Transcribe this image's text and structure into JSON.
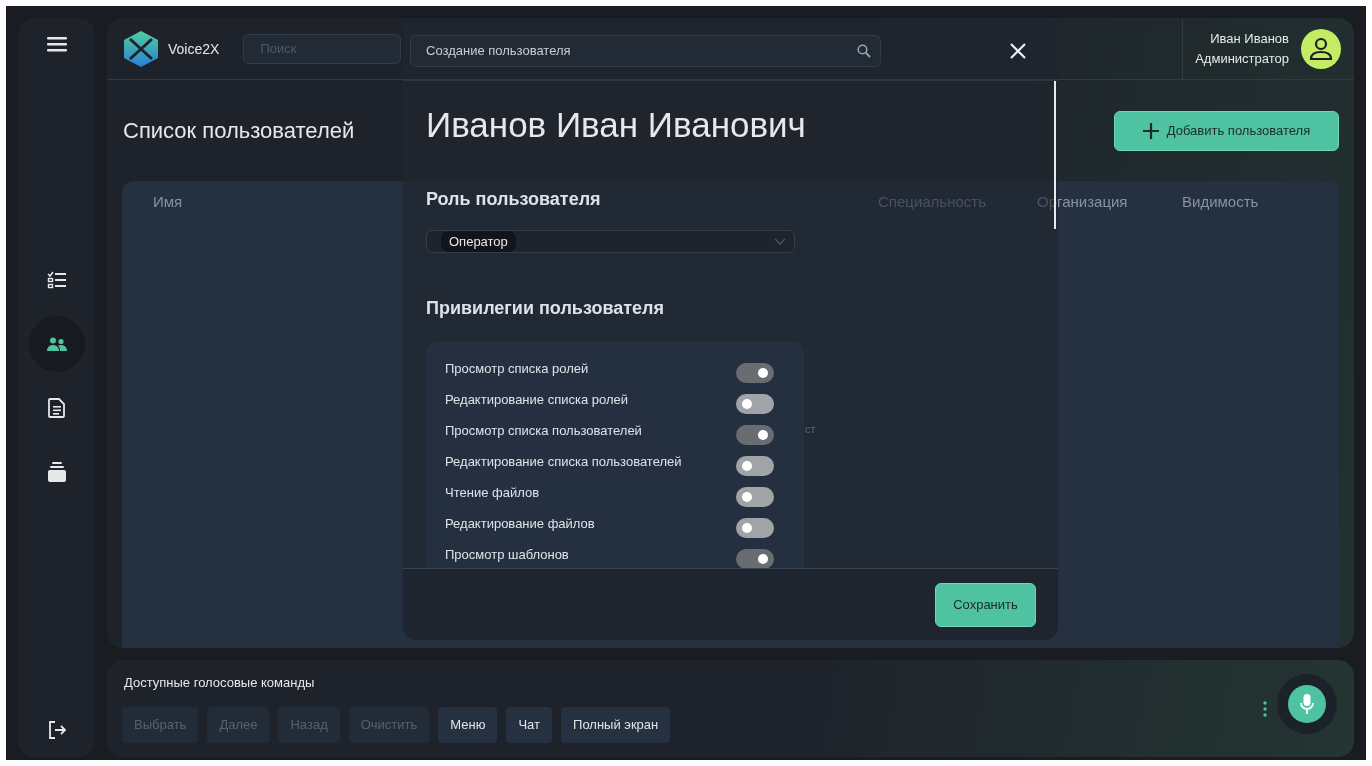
{
  "sidebar": {
    "nav": [
      {
        "kind": "checklist",
        "selected": false
      },
      {
        "kind": "users",
        "selected": true
      },
      {
        "kind": "document",
        "selected": false
      },
      {
        "kind": "archive",
        "selected": false
      }
    ]
  },
  "header": {
    "logo_text": "Voice2X",
    "search": {
      "placeholder": "Поиск"
    },
    "user": {
      "name": "Иван Иванов",
      "role": "Администратор"
    }
  },
  "page": {
    "title": "Список пользователей",
    "add_button": "Добавить пользователя"
  },
  "table": {
    "columns": [
      "Имя",
      "Специальность",
      "Организация",
      "Видимость"
    ],
    "empty_text": "ст"
  },
  "voice_bar": {
    "title": "Доступные голосовые команды",
    "commands": [
      {
        "label": "Выбрать",
        "disabled": true
      },
      {
        "label": "Далее",
        "disabled": true
      },
      {
        "label": "Назад",
        "disabled": true
      },
      {
        "label": "Очистить",
        "disabled": true
      },
      {
        "label": "Меню",
        "disabled": false
      },
      {
        "label": "Чат",
        "disabled": false
      },
      {
        "label": "Полный экран",
        "disabled": false
      }
    ]
  },
  "modal": {
    "header_field": {
      "value": "Создание пользователя"
    },
    "name": "Иванов Иван Иванович",
    "role_title": "Роль пользователя",
    "role": {
      "chip": "Оператор"
    },
    "privileges_title": "Привилегии пользователя",
    "privileges": [
      {
        "label": "Просмотр списка ролей",
        "on": true
      },
      {
        "label": "Редактирование списка ролей",
        "on": false
      },
      {
        "label": "Просмотр списка пользователей",
        "on": true
      },
      {
        "label": "Редактирование списка пользователей",
        "on": false
      },
      {
        "label": "Чтение файлов",
        "on": false
      },
      {
        "label": "Редактирование файлов",
        "on": false
      },
      {
        "label": "Просмотр шаблонов",
        "on": true
      }
    ],
    "save_button": "Сохранить"
  }
}
